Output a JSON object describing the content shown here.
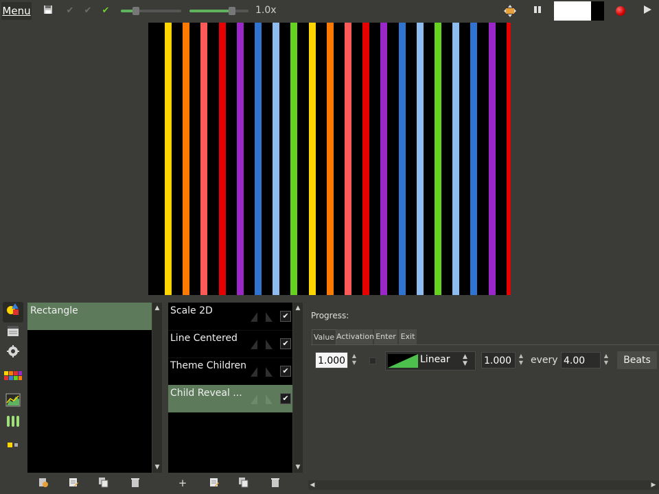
{
  "toolbar": {
    "menu_label": "Menu",
    "zoom_label": "1.0x",
    "speed_level": 0.25,
    "volume_level": 0.72,
    "preview_colors": [
      "#ffffff",
      "#000000"
    ]
  },
  "canvas": {
    "stripe_colors": [
      "#ffd500",
      "#ff7a00",
      "#ff5a5a",
      "#e60000",
      "#9b27c9",
      "#2f74d0",
      "#8dbdf0",
      "#64d21e",
      "#ffd500",
      "#ff7a00",
      "#ff5a5a",
      "#e60000",
      "#9b27c9",
      "#2f74d0",
      "#8dbdf0",
      "#64d21e",
      "#8dbdf0",
      "#2f74d0",
      "#9b27c9",
      "#e60000",
      "#ff5a5a",
      "#ff7a00",
      "#ffd500"
    ]
  },
  "layers": {
    "items": [
      {
        "label": "Rectangle",
        "selected": true
      }
    ]
  },
  "effects": {
    "items": [
      {
        "label": "Scale 2D",
        "checked": true,
        "selected": false
      },
      {
        "label": "Line Centered",
        "checked": true,
        "selected": false
      },
      {
        "label": "Theme Children",
        "checked": true,
        "selected": false
      },
      {
        "label": "Child Reveal ...",
        "checked": true,
        "selected": true
      }
    ]
  },
  "properties": {
    "title": "Progress:",
    "tabs": [
      "Value",
      "Activation",
      "Enter",
      "Exit"
    ],
    "active_tab": "Value",
    "value": "1.000",
    "curve": "Linear",
    "amount": "1.000",
    "every_label": "every",
    "period": "4.00",
    "unit": "Beats"
  },
  "icons": {
    "save": "save-icon",
    "check_gray_1": "check-icon",
    "check_gray_2": "check-icon",
    "check_green": "check-icon",
    "fullscreen": "fullscreen-icon",
    "pause": "pause-icon",
    "record": "record-icon",
    "play": "play-icon"
  },
  "colors": {
    "accent_green": "#5fb35f",
    "selection": "#5d7a5b",
    "record_red": "#d10000"
  }
}
